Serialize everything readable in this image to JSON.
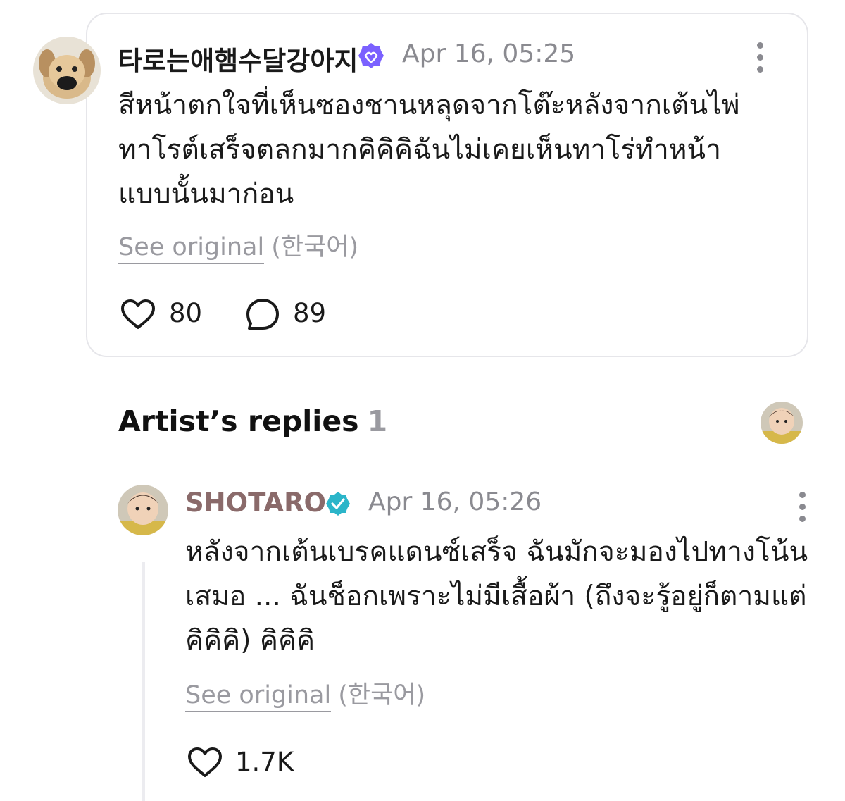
{
  "post": {
    "author_name": "타로는애햄수달강아지",
    "verified_icon": "verified-badge-purple",
    "date": "Apr 16, 05:25",
    "text": "สีหน้าตกใจที่เห็นซองชานหลุดจากโต๊ะหลังจากเต้นไพ่ทาโรต์เสร็จตลกมากคิคิคิฉันไม่เคยเห็นทาโร่ทำหน้าแบบนั้นมาก่อน",
    "see_original": "See original",
    "original_language": "(한국어)",
    "likes": "80",
    "comments": "89",
    "colors": {
      "badge": "#7b61ff",
      "muted": "#8a8a90"
    }
  },
  "artist_replies": {
    "title": "Artist’s replies",
    "count": "1"
  },
  "reply": {
    "author_name": "SHOTARO",
    "verified_icon": "verified-badge-teal",
    "date": "Apr 16, 05:26",
    "text": "หลังจากเต้นเบรคแดนซ์เสร็จ ฉันมักจะมองไปทางโน้นเสมอ ... ฉันช็อกเพราะไม่มีเสื้อผ้า (ถึงจะรู้อยู่ก็ตามแต่คิคิคิ) คิคิคิ",
    "see_original": "See original",
    "original_language": "(한국어)",
    "likes": "1.7K",
    "colors": {
      "badge": "#2bb5c9",
      "name": "#8a6a6a"
    }
  }
}
